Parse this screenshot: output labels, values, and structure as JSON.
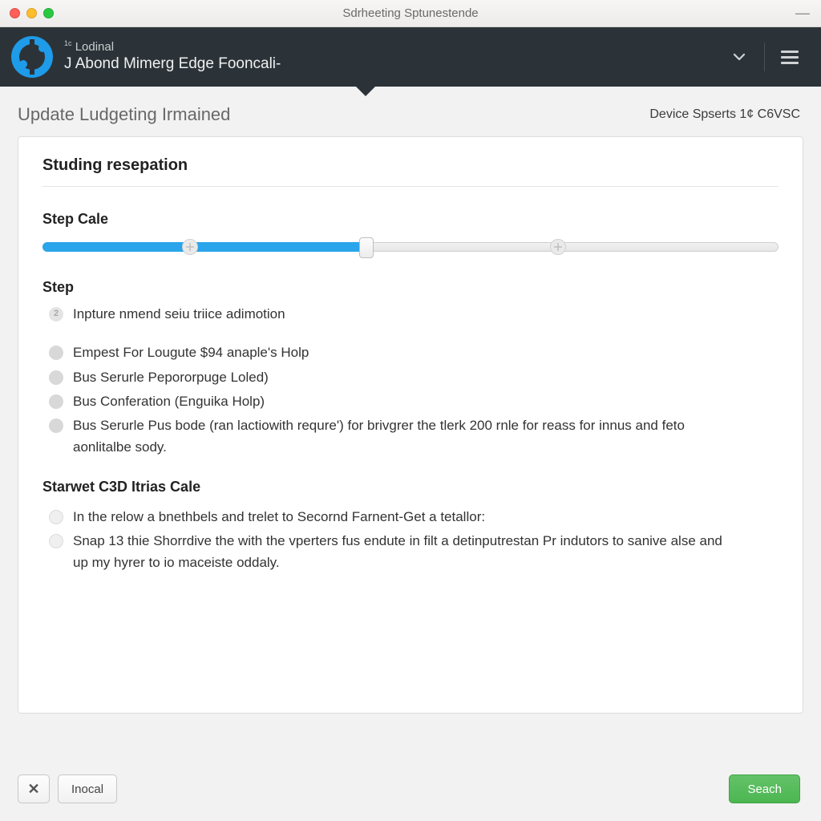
{
  "window": {
    "title": "Sdrheeting Sptunestende"
  },
  "header": {
    "line1_pre": "1c",
    "line1": "Lodinal",
    "line2": "J Abond Mimerg Edge Fooncali-"
  },
  "subheader": {
    "left": "Update Ludgeting Irmained",
    "right": "Device Spserts 1¢ C6VSC"
  },
  "card": {
    "title": "Studing resepation",
    "slider_label": "Step Cale",
    "slider_value_pct": 44,
    "step_heading": "Step",
    "steps": [
      {
        "marker": "2",
        "kind": "num",
        "text": "Inpture nmend seiu triice adimotion"
      },
      {
        "marker": "",
        "kind": "grey",
        "text": "Empest For Lougute $94 anaple's Holp"
      },
      {
        "marker": "",
        "kind": "grey",
        "text": "Bus Serurle Pepororpuge Loled)"
      },
      {
        "marker": "",
        "kind": "grey",
        "text": "Bus Conferation (Enguika Holp)"
      },
      {
        "marker": "",
        "kind": "grey",
        "text": "Bus Serurle Pus bode (ran lactiowith requre') for brivgrer the tlerk 200 rnle for reass for innus and feto aonlitalbe sody."
      }
    ],
    "section2_heading": "Starwet C3D Itrias Cale",
    "notes": [
      "In the relow a bnethbels and trelet to Secornd Farnent-Get a tetallor:",
      "Snap 13 thie Shorrdive the with the vperters fus endute in filt a detinputrestan Pr indutors to sanive alse and up my hyrer to io maceiste oddaly."
    ]
  },
  "footer": {
    "cancel": "Inocal",
    "primary": "Seach"
  }
}
